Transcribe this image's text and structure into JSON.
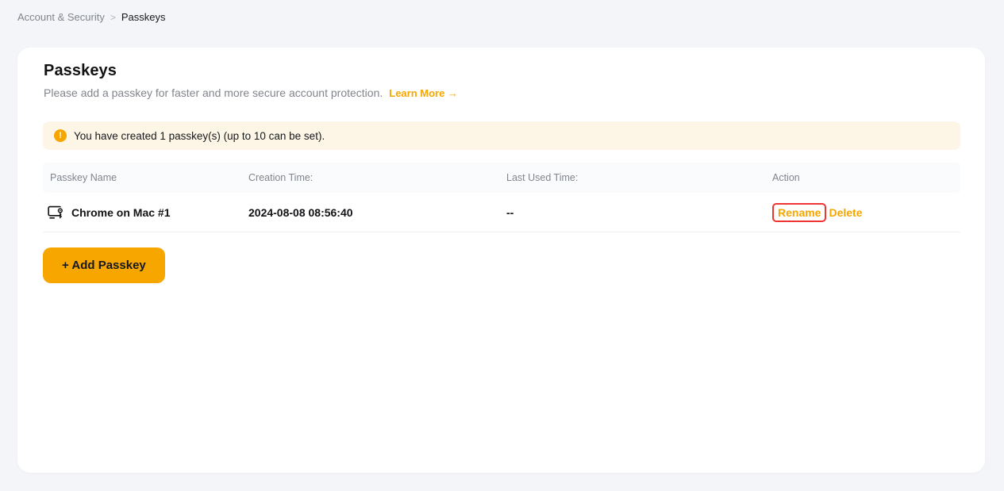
{
  "breadcrumb": {
    "parent": "Account & Security",
    "separator": ">",
    "current": "Passkeys"
  },
  "page": {
    "title": "Passkeys",
    "description": "Please add a passkey for faster and more secure account protection.",
    "learn_more_label": "Learn More →"
  },
  "banner": {
    "icon": "warning-circle-icon",
    "icon_glyph": "!",
    "text": "You have created 1 passkey(s) (up to 10 can be set)."
  },
  "table": {
    "headers": [
      "Passkey Name",
      "Creation Time:",
      "Last Used Time:",
      "Action"
    ],
    "rows": [
      {
        "icon": "device-passkey-icon",
        "name": "Chrome on Mac #1",
        "creation_time": "2024-08-08 08:56:40",
        "last_used_time": "--",
        "actions": {
          "rename": "Rename",
          "delete": "Delete"
        }
      }
    ]
  },
  "buttons": {
    "add_passkey": "+ Add Passkey"
  },
  "colors": {
    "accent_orange": "#f7a600",
    "banner_bg": "#fdf6e6",
    "highlight_red": "#ef3434",
    "page_bg": "#f4f5f8",
    "text_primary": "#121214",
    "text_secondary": "#81858c"
  }
}
